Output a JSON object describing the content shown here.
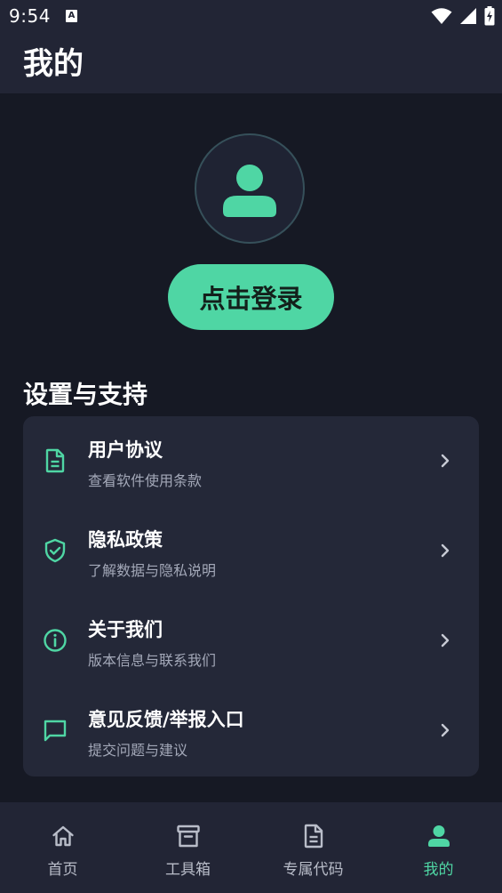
{
  "status_bar": {
    "time": "9:54",
    "notification_glyph": "A"
  },
  "header": {
    "title": "我的"
  },
  "profile": {
    "avatar_icon": "person-icon",
    "login_label": "点击登录"
  },
  "settings": {
    "section_title": "设置与支持",
    "items": [
      {
        "title": "用户协议",
        "subtitle": "查看软件使用条款",
        "icon": "document-icon"
      },
      {
        "title": "隐私政策",
        "subtitle": "了解数据与隐私说明",
        "icon": "shield-check-icon"
      },
      {
        "title": "关于我们",
        "subtitle": "版本信息与联系我们",
        "icon": "info-icon"
      },
      {
        "title": "意见反馈/举报入口",
        "subtitle": "提交问题与建议",
        "icon": "chat-bubble-icon"
      }
    ]
  },
  "bottom_nav": {
    "items": [
      {
        "label": "首页",
        "icon": "home-icon",
        "active": false
      },
      {
        "label": "工具箱",
        "icon": "archive-box-icon",
        "active": false
      },
      {
        "label": "专属代码",
        "icon": "document-icon",
        "active": false
      },
      {
        "label": "我的",
        "icon": "person-icon",
        "active": true
      }
    ]
  },
  "colors": {
    "accent": "#4fd6a4",
    "background": "#161924",
    "surface": "#242838",
    "bar": "#222535"
  }
}
